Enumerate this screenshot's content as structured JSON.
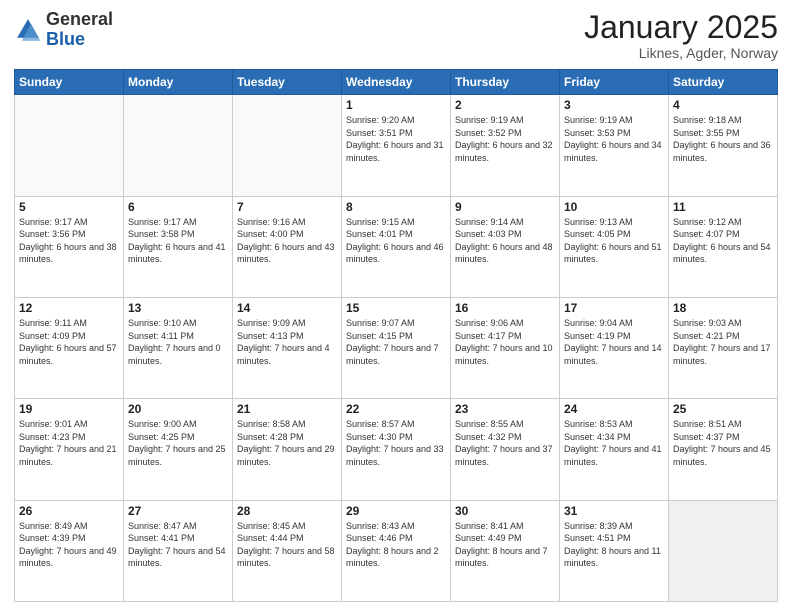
{
  "header": {
    "logo": {
      "general": "General",
      "blue": "Blue"
    },
    "title": "January 2025",
    "subtitle": "Liknes, Agder, Norway"
  },
  "weekdays": [
    "Sunday",
    "Monday",
    "Tuesday",
    "Wednesday",
    "Thursday",
    "Friday",
    "Saturday"
  ],
  "weeks": [
    [
      {
        "day": "",
        "info": ""
      },
      {
        "day": "",
        "info": ""
      },
      {
        "day": "",
        "info": ""
      },
      {
        "day": "1",
        "info": "Sunrise: 9:20 AM\nSunset: 3:51 PM\nDaylight: 6 hours and 31 minutes."
      },
      {
        "day": "2",
        "info": "Sunrise: 9:19 AM\nSunset: 3:52 PM\nDaylight: 6 hours and 32 minutes."
      },
      {
        "day": "3",
        "info": "Sunrise: 9:19 AM\nSunset: 3:53 PM\nDaylight: 6 hours and 34 minutes."
      },
      {
        "day": "4",
        "info": "Sunrise: 9:18 AM\nSunset: 3:55 PM\nDaylight: 6 hours and 36 minutes."
      }
    ],
    [
      {
        "day": "5",
        "info": "Sunrise: 9:17 AM\nSunset: 3:56 PM\nDaylight: 6 hours and 38 minutes."
      },
      {
        "day": "6",
        "info": "Sunrise: 9:17 AM\nSunset: 3:58 PM\nDaylight: 6 hours and 41 minutes."
      },
      {
        "day": "7",
        "info": "Sunrise: 9:16 AM\nSunset: 4:00 PM\nDaylight: 6 hours and 43 minutes."
      },
      {
        "day": "8",
        "info": "Sunrise: 9:15 AM\nSunset: 4:01 PM\nDaylight: 6 hours and 46 minutes."
      },
      {
        "day": "9",
        "info": "Sunrise: 9:14 AM\nSunset: 4:03 PM\nDaylight: 6 hours and 48 minutes."
      },
      {
        "day": "10",
        "info": "Sunrise: 9:13 AM\nSunset: 4:05 PM\nDaylight: 6 hours and 51 minutes."
      },
      {
        "day": "11",
        "info": "Sunrise: 9:12 AM\nSunset: 4:07 PM\nDaylight: 6 hours and 54 minutes."
      }
    ],
    [
      {
        "day": "12",
        "info": "Sunrise: 9:11 AM\nSunset: 4:09 PM\nDaylight: 6 hours and 57 minutes."
      },
      {
        "day": "13",
        "info": "Sunrise: 9:10 AM\nSunset: 4:11 PM\nDaylight: 7 hours and 0 minutes."
      },
      {
        "day": "14",
        "info": "Sunrise: 9:09 AM\nSunset: 4:13 PM\nDaylight: 7 hours and 4 minutes."
      },
      {
        "day": "15",
        "info": "Sunrise: 9:07 AM\nSunset: 4:15 PM\nDaylight: 7 hours and 7 minutes."
      },
      {
        "day": "16",
        "info": "Sunrise: 9:06 AM\nSunset: 4:17 PM\nDaylight: 7 hours and 10 minutes."
      },
      {
        "day": "17",
        "info": "Sunrise: 9:04 AM\nSunset: 4:19 PM\nDaylight: 7 hours and 14 minutes."
      },
      {
        "day": "18",
        "info": "Sunrise: 9:03 AM\nSunset: 4:21 PM\nDaylight: 7 hours and 17 minutes."
      }
    ],
    [
      {
        "day": "19",
        "info": "Sunrise: 9:01 AM\nSunset: 4:23 PM\nDaylight: 7 hours and 21 minutes."
      },
      {
        "day": "20",
        "info": "Sunrise: 9:00 AM\nSunset: 4:25 PM\nDaylight: 7 hours and 25 minutes."
      },
      {
        "day": "21",
        "info": "Sunrise: 8:58 AM\nSunset: 4:28 PM\nDaylight: 7 hours and 29 minutes."
      },
      {
        "day": "22",
        "info": "Sunrise: 8:57 AM\nSunset: 4:30 PM\nDaylight: 7 hours and 33 minutes."
      },
      {
        "day": "23",
        "info": "Sunrise: 8:55 AM\nSunset: 4:32 PM\nDaylight: 7 hours and 37 minutes."
      },
      {
        "day": "24",
        "info": "Sunrise: 8:53 AM\nSunset: 4:34 PM\nDaylight: 7 hours and 41 minutes."
      },
      {
        "day": "25",
        "info": "Sunrise: 8:51 AM\nSunset: 4:37 PM\nDaylight: 7 hours and 45 minutes."
      }
    ],
    [
      {
        "day": "26",
        "info": "Sunrise: 8:49 AM\nSunset: 4:39 PM\nDaylight: 7 hours and 49 minutes."
      },
      {
        "day": "27",
        "info": "Sunrise: 8:47 AM\nSunset: 4:41 PM\nDaylight: 7 hours and 54 minutes."
      },
      {
        "day": "28",
        "info": "Sunrise: 8:45 AM\nSunset: 4:44 PM\nDaylight: 7 hours and 58 minutes."
      },
      {
        "day": "29",
        "info": "Sunrise: 8:43 AM\nSunset: 4:46 PM\nDaylight: 8 hours and 2 minutes."
      },
      {
        "day": "30",
        "info": "Sunrise: 8:41 AM\nSunset: 4:49 PM\nDaylight: 8 hours and 7 minutes."
      },
      {
        "day": "31",
        "info": "Sunrise: 8:39 AM\nSunset: 4:51 PM\nDaylight: 8 hours and 11 minutes."
      },
      {
        "day": "",
        "info": ""
      }
    ]
  ]
}
